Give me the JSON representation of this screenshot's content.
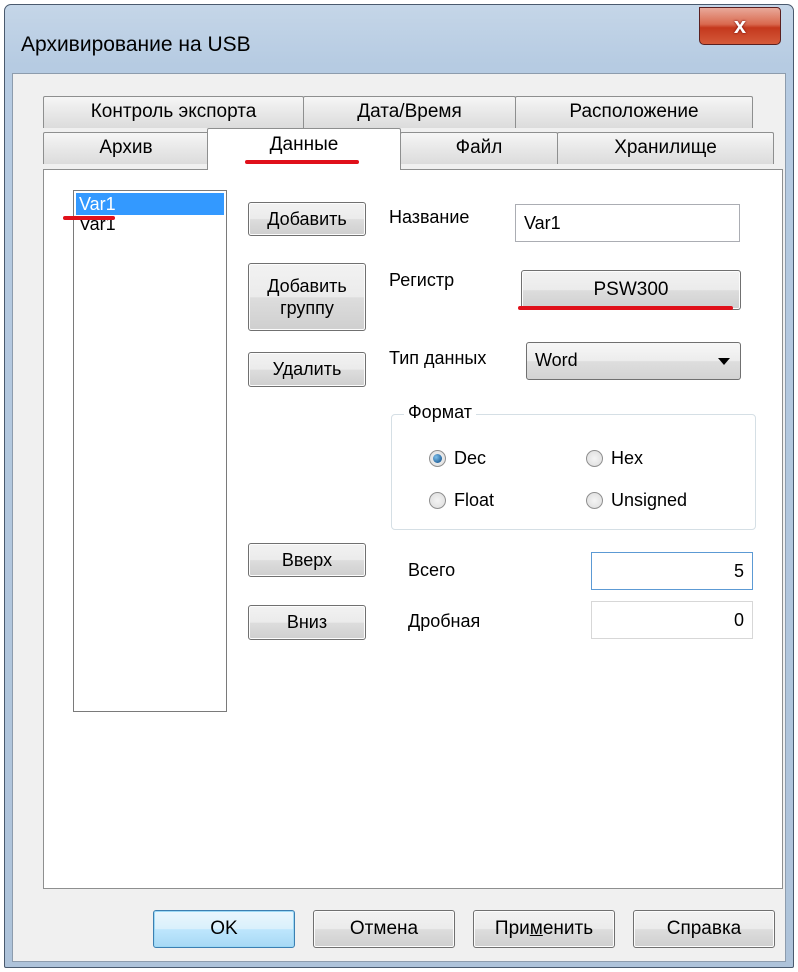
{
  "window": {
    "title": "Архивирование на USB",
    "close_glyph": "x"
  },
  "tabs_row1": [
    {
      "label": "Контроль экспорта"
    },
    {
      "label": "Дата/Время"
    },
    {
      "label": "Расположение"
    }
  ],
  "tabs_row2": [
    {
      "label": "Архив"
    },
    {
      "label": "Данные",
      "active": true
    },
    {
      "label": "Файл"
    },
    {
      "label": "Хранилище"
    }
  ],
  "var_list": {
    "items": [
      "Var1",
      "Var1"
    ],
    "selected_index": 0
  },
  "buttons": {
    "add": "Добавить",
    "add_group_line1": "Добавить",
    "add_group_line2": "группу",
    "delete": "Удалить",
    "up": "Вверх",
    "down": "Вниз"
  },
  "fields": {
    "name_label": "Название",
    "name_value": "Var1",
    "register_label": "Регистр",
    "register_value": "PSW300",
    "datatype_label": "Тип данных",
    "datatype_value": "Word",
    "total_label": "Всего",
    "total_value": "5",
    "fraction_label": "Дробная",
    "fraction_value": "0"
  },
  "format": {
    "title": "Формат",
    "options": [
      "Dec",
      "Hex",
      "Float",
      "Unsigned"
    ],
    "selected": "Dec"
  },
  "footer": {
    "ok": "OK",
    "cancel": "Отмена",
    "apply_pre": "При",
    "apply_u": "м",
    "apply_post": "енить",
    "help": "Справка"
  },
  "colors": {
    "highlight_red": "#e0101a",
    "selection_blue": "#3399ff"
  }
}
